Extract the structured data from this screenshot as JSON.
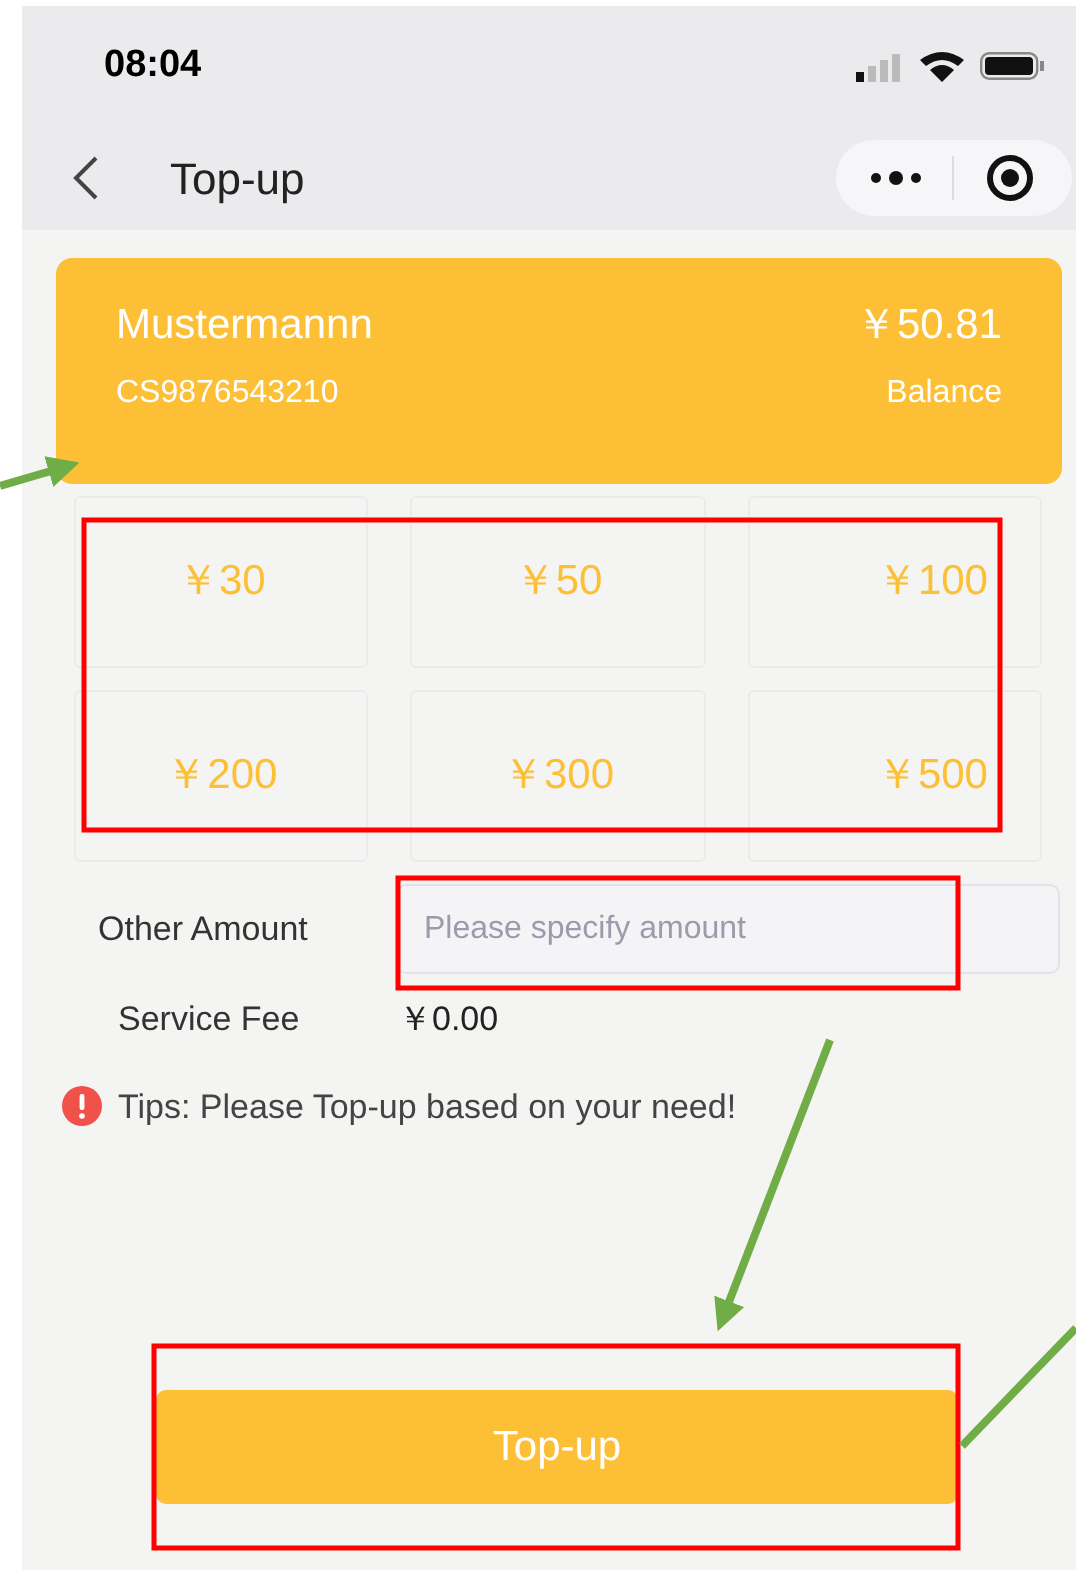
{
  "status_bar": {
    "time": "08:04"
  },
  "nav": {
    "title": "Top-up"
  },
  "account": {
    "name": "Mustermannn",
    "id": "CS9876543210",
    "amount": "￥50.81",
    "amount_label": "Balance"
  },
  "amounts": [
    {
      "label": "￥30",
      "selected": false
    },
    {
      "label": "￥50",
      "selected": false
    },
    {
      "label": "￥100",
      "selected": false
    },
    {
      "label": "￥200",
      "selected": false
    },
    {
      "label": "￥300",
      "selected": false
    },
    {
      "label": "￥500",
      "selected": false
    }
  ],
  "other_amount": {
    "label": "Other Amount",
    "placeholder": "Please specify amount"
  },
  "service_fee": {
    "label": "Service Fee",
    "value": "￥0.00"
  },
  "tip": "Tips: Please Top-up based on your need!",
  "button": "Top-up"
}
